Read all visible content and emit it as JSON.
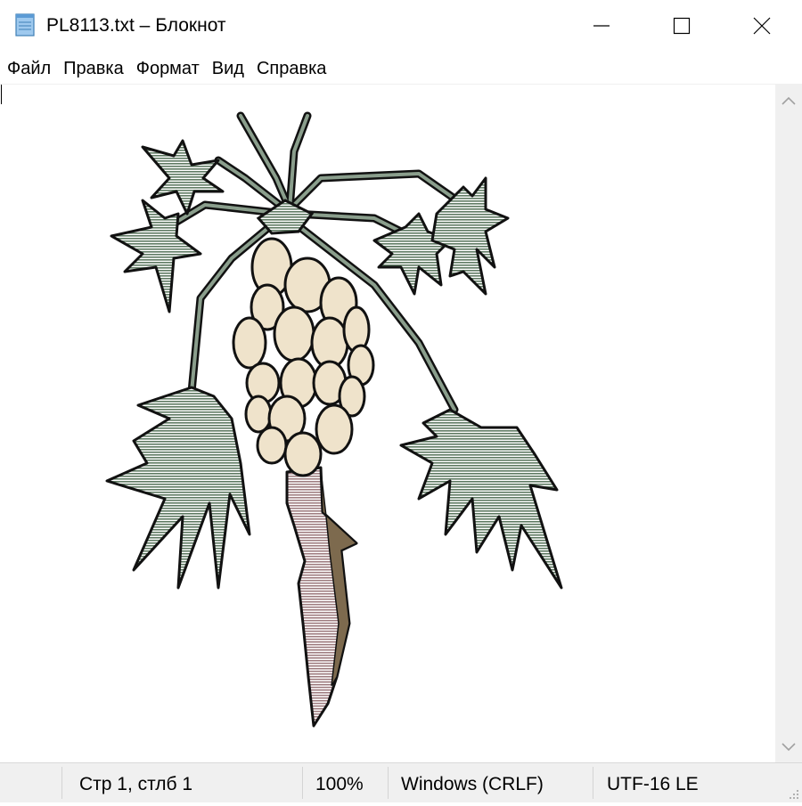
{
  "window": {
    "title": "PL8113.txt – Блокнот",
    "minimize_glyph": "minimize-icon",
    "maximize_glyph": "maximize-icon",
    "close_glyph": "close-icon"
  },
  "menu": {
    "items": [
      {
        "label": "Файл"
      },
      {
        "label": "Правка"
      },
      {
        "label": "Формат"
      },
      {
        "label": "Вид"
      },
      {
        "label": "Справка"
      }
    ]
  },
  "statusbar": {
    "position": "Стр 1, стлб 1",
    "zoom": "100%",
    "line_endings": "Windows (CRLF)",
    "encoding": "UTF-16 LE"
  },
  "colors": {
    "leaf": "#8a9e8c",
    "fruit": "#efe3cb",
    "trunk": "#b89a9c",
    "trunk_shade": "#7d6a4e",
    "outline": "#111111",
    "chrome": "#f0f0f0"
  }
}
